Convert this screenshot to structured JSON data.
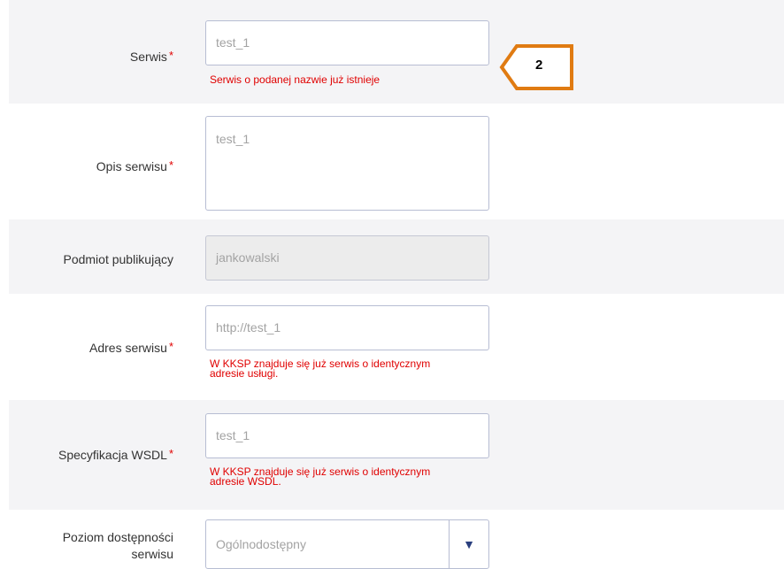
{
  "fields": {
    "serwis": {
      "label": "Serwis",
      "required_mark": "*",
      "value": "test_1",
      "error": "Serwis o podanej nazwie już istnieje"
    },
    "opis": {
      "label": "Opis serwisu",
      "required_mark": "*",
      "value": "test_1"
    },
    "podmiot": {
      "label": "Podmiot publikujący",
      "value": "jankowalski"
    },
    "adres": {
      "label": "Adres serwisu",
      "required_mark": "*",
      "value": "http://test_1",
      "error_line1": "W KKSP znajduje się już serwis o identycznym",
      "error_line2": "adresie usługi."
    },
    "wsdl": {
      "label": "Specyfikacja WSDL",
      "required_mark": "*",
      "value": "test_1",
      "error_line1": "W KKSP znajduje się już serwis o identycznym",
      "error_line2": "adresie WSDL."
    },
    "poziom": {
      "label_line1": "Poziom dostępności",
      "label_line2": "serwisu",
      "selected": "Ogólnodostępny",
      "arrow_icon": "triangle-down-icon"
    }
  },
  "annotation": {
    "number": "2",
    "color": "#e07b12"
  },
  "colors": {
    "error": "#e00000",
    "required": "#e00000",
    "row_alt_bg": "#f4f4f6",
    "field_border": "#b7bdd3",
    "disabled_bg": "#ececec"
  }
}
